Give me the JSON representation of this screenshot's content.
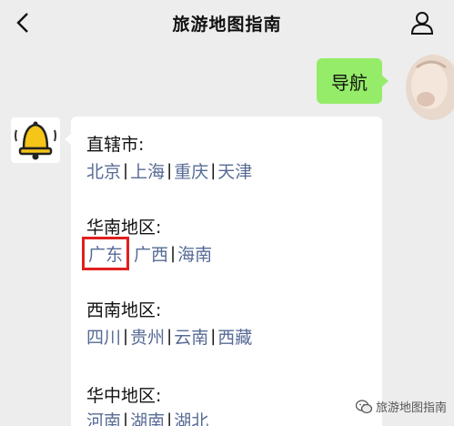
{
  "header": {
    "title": "旅游地图指南",
    "back_icon": "chevron-left-icon",
    "profile_icon": "person-icon"
  },
  "messages": {
    "sent_text": "导航",
    "bot_avatar_icon": "bell-icon",
    "regions": [
      {
        "title": "直辖市:",
        "cities": [
          "北京",
          "上海",
          "重庆",
          "天津"
        ]
      },
      {
        "title": "华南地区:",
        "cities": [
          "广东",
          "广西",
          "海南"
        ]
      },
      {
        "title": "西南地区:",
        "cities": [
          "四川",
          "贵州",
          "云南",
          "西藏"
        ]
      },
      {
        "title": "华中地区:",
        "cities": [
          "河南",
          "湖南",
          "湖北"
        ]
      }
    ]
  },
  "watermark": {
    "text": "旅游地图指南",
    "icon": "wechat-icon"
  },
  "colors": {
    "link": "#576b95",
    "bubble_green": "#95ec69",
    "highlight_red": "#e02020",
    "background": "#ededed"
  }
}
